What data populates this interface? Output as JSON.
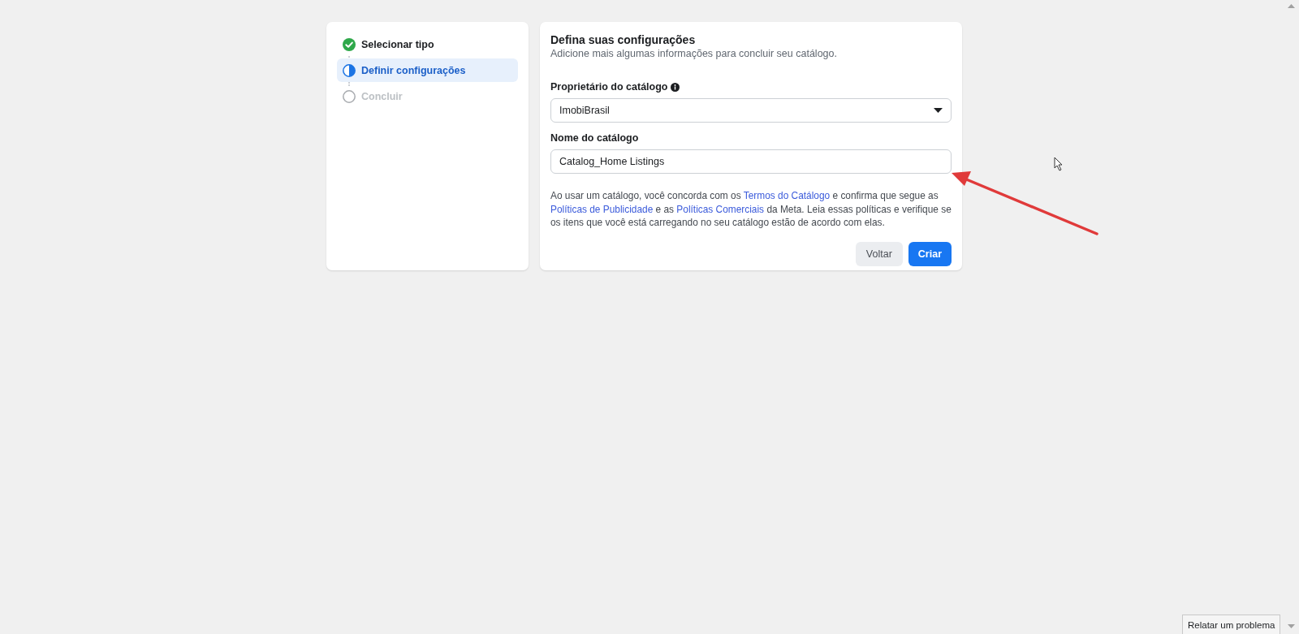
{
  "steps": [
    {
      "label": "Selecionar tipo",
      "kind": "complete",
      "selected": false
    },
    {
      "label": "Definir configurações",
      "kind": "current",
      "selected": true
    },
    {
      "label": "Concluir",
      "kind": "pending",
      "selected": false
    }
  ],
  "form": {
    "title": "Defina suas configurações",
    "subtitle": "Adicione mais algumas informações para concluir seu catálogo.",
    "owner": {
      "label": "Proprietário do catálogo",
      "value": "ImobiBrasil"
    },
    "name": {
      "label": "Nome do catálogo",
      "value": "Catalog_Home Listings"
    },
    "notice": [
      {
        "kind": "text",
        "text": "Ao usar um catálogo, você concorda com os "
      },
      {
        "kind": "link",
        "text": "Termos do Catálogo"
      },
      {
        "kind": "text",
        "text": " e confirma que segue as "
      },
      {
        "kind": "link",
        "text": "Políticas de Publicidade"
      },
      {
        "kind": "text",
        "text": " e as "
      },
      {
        "kind": "link",
        "text": "Políticas Comerciais"
      },
      {
        "kind": "text",
        "text": " da Meta. Leia essas políticas e verifique se os itens que você está carregando no seu catálogo estão de acordo com elas."
      }
    ],
    "buttons": [
      {
        "label": "Voltar",
        "kind": "secondary"
      },
      {
        "label": "Criar",
        "kind": "primary"
      }
    ]
  },
  "report_button": "Relatar um problema"
}
